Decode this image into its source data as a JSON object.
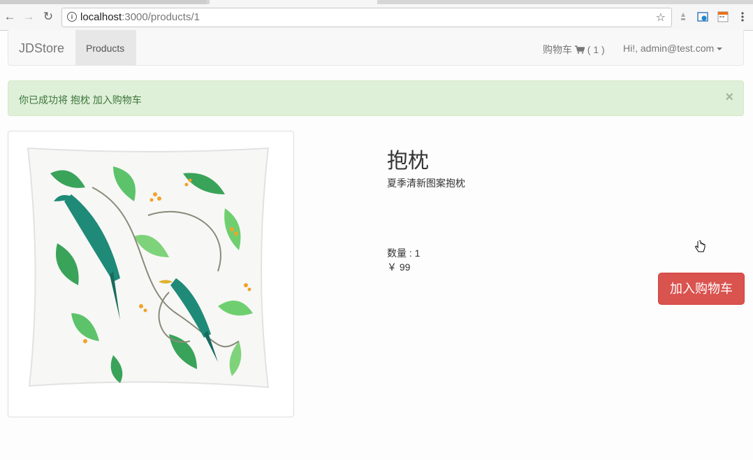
{
  "browser": {
    "url_host": "localhost",
    "url_path": ":3000/products/1",
    "icons": [
      "back-arrow-icon",
      "forward-arrow-icon",
      "reload-icon",
      "info-icon",
      "bookmark-star-icon",
      "extension-icon",
      "camera-icon",
      "calendar-icon",
      "menu-dots-icon"
    ]
  },
  "navbar": {
    "brand": "JDStore",
    "products_label": "Products",
    "cart_label": "购物车",
    "cart_count": "( 1 )",
    "user_label": "Hi!, admin@test.com"
  },
  "alert": {
    "message": "你已成功将 抱枕 加入购物车",
    "close_symbol": "×",
    "color": "#dff0d8"
  },
  "product": {
    "title": "抱枕",
    "description": "夏季清新图案抱枕",
    "quantity_label": "数量 : 1",
    "price_label": "￥ 99",
    "add_to_cart_label": "加入购物车",
    "button_color": "#d9534f"
  }
}
